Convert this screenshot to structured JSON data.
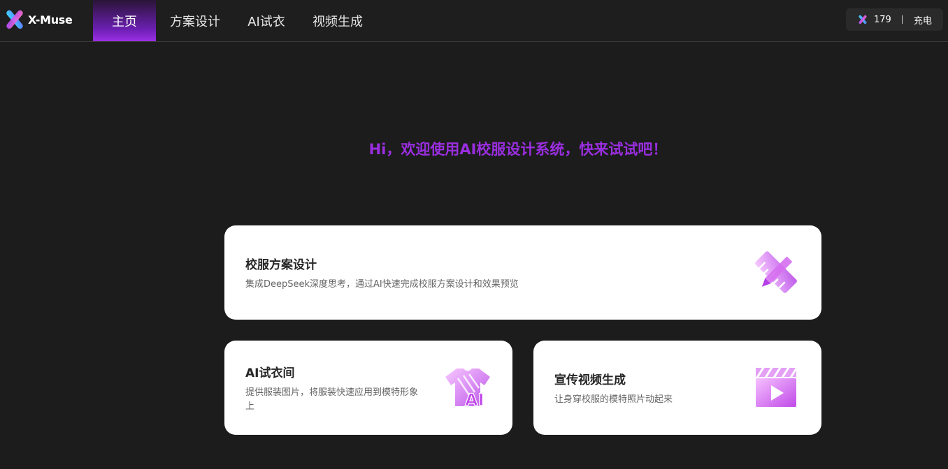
{
  "app": {
    "name": "X-Muse",
    "brand_color": "#9a2ee0"
  },
  "nav": {
    "items": [
      {
        "label": "主页",
        "active": true
      },
      {
        "label": "方案设计",
        "active": false
      },
      {
        "label": "AI试衣",
        "active": false
      },
      {
        "label": "视频生成",
        "active": false
      }
    ]
  },
  "credits": {
    "icon": "x-logo-icon",
    "count": "179",
    "charge_label": "充电"
  },
  "hero": {
    "greeting": "Hi，欢迎使用AI校服设计系统，快来试试吧！"
  },
  "cards": [
    {
      "title": "校服方案设计",
      "description": "集成DeepSeek深度思考，通过AI快速完成校服方案设计和效果预览",
      "icon": "pencil-ruler-icon"
    },
    {
      "title": "AI试衣间",
      "description": "提供服装图片，将服装快速应用到模特形象上",
      "icon": "ai-shirt-icon"
    },
    {
      "title": "宣传视频生成",
      "description": "让身穿校服的模特照片动起来",
      "icon": "video-clapper-icon"
    }
  ]
}
